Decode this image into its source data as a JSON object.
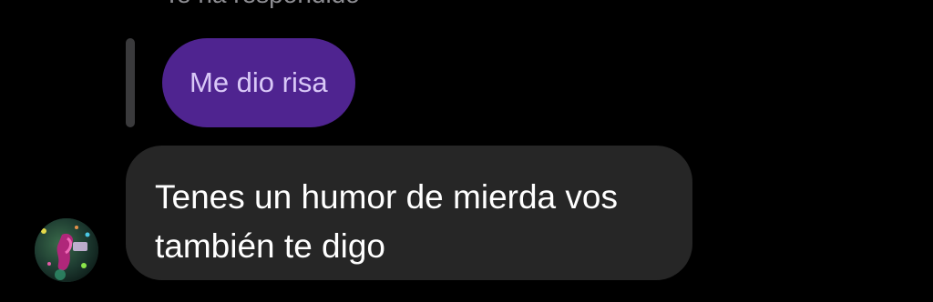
{
  "reply": {
    "header_text": "Te ha respondido",
    "quoted_message": "Me dio risa"
  },
  "message": {
    "line1": "Tenes un humor de mierda vos",
    "line2": "también te digo"
  },
  "sender": {
    "avatar_icon": "profile-photo-avatar"
  },
  "colors": {
    "background": "#000000",
    "quoted_bubble": "#4f2490",
    "quoted_text": "#d9c8f7",
    "message_bubble": "#262626",
    "message_text": "#ffffff",
    "reply_bar": "#3a3a3c"
  }
}
